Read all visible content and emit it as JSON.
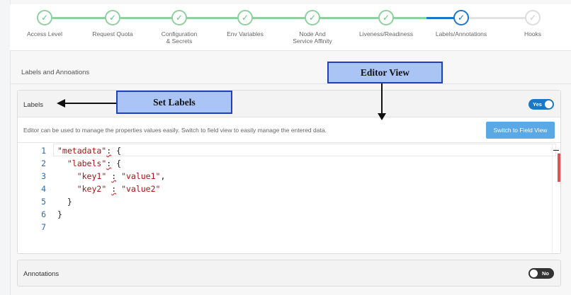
{
  "stepper": {
    "steps": [
      {
        "label": "Access Level",
        "state": "done"
      },
      {
        "label": "Request Quota",
        "state": "done"
      },
      {
        "label": "Configuration & Secrets",
        "state": "done"
      },
      {
        "label": "Env Variables",
        "state": "done"
      },
      {
        "label": "Node And Service Affinity",
        "state": "done"
      },
      {
        "label": "Liveness/Readiness",
        "state": "done"
      },
      {
        "label": "Labels/Annotations",
        "state": "active"
      },
      {
        "label": "Hooks",
        "state": "pending"
      }
    ]
  },
  "section": {
    "title": "Labels and Annoations"
  },
  "labels_card": {
    "title": "Labels",
    "toggle": "Yes",
    "info": "Editor can be used to manage the properties values easily. Switch to field view to easily manage the entered data.",
    "switch_button": "Switch to Field View"
  },
  "editor": {
    "line_numbers": [
      "1",
      "2",
      "3",
      "4",
      "5",
      "6",
      "7"
    ]
  },
  "annotations_card": {
    "title": "Annotations",
    "toggle": "No"
  },
  "callouts": {
    "editor_view": "Editor View",
    "set_labels": "Set Labels"
  },
  "colors": {
    "accent": "#1d77c7",
    "done": "#8fd19e",
    "callout_fill": "#a9c4f5",
    "callout_border": "#2240b8"
  }
}
